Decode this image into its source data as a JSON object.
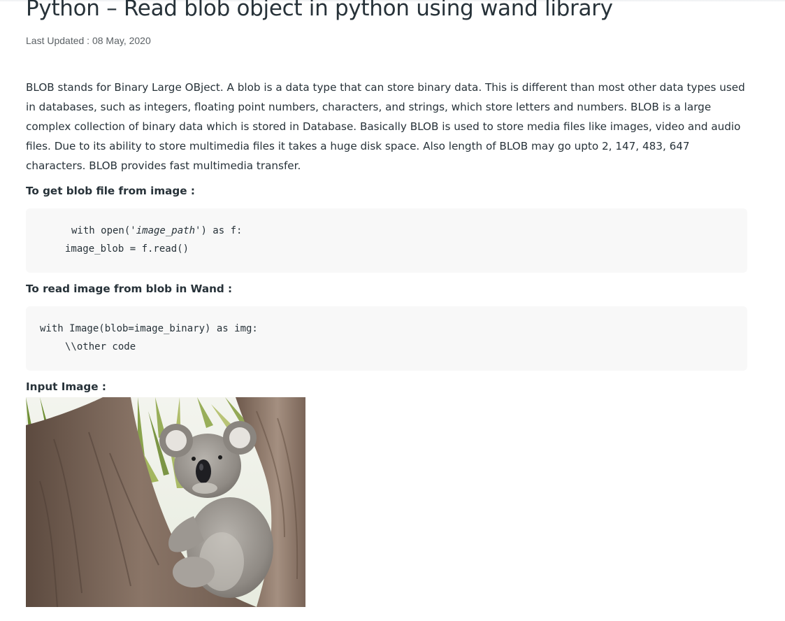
{
  "article": {
    "title": "Python – Read blob object in python using wand library",
    "last_updated": "Last Updated : 08 May, 2020",
    "intro": "BLOB stands for Binary Large OBject. A blob is a data type that can store binary data. This is different than most other data types used in databases, such as integers, floating point numbers, characters, and strings, which store letters and numbers. BLOB is a large complex collection of binary data which is stored in Database. Basically BLOB is used to store media files like images, video and audio files. Due to its ability to store multimedia files it takes a huge disk space. Also length of BLOB may go upto 2, 147, 483, 647 characters. BLOB provides fast multimedia transfer.",
    "section1_label": "To get blob file from image :",
    "code1": {
      "line1_prefix": "with open('",
      "line1_italic": "image_path",
      "line1_suffix": "') as f:",
      "line2": "image_blob = f.read()"
    },
    "section2_label": "To read image from blob in Wand :",
    "code2": {
      "line1": "with Image(blob=image_binary) as img:",
      "line2": "\\\\other code"
    },
    "section3_label": "Input Image :"
  }
}
